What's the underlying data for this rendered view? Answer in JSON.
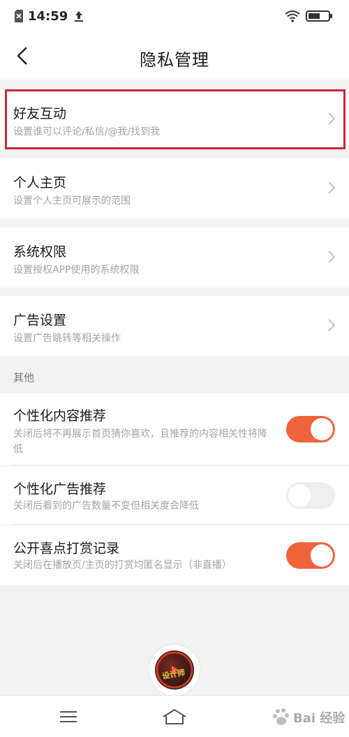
{
  "status_bar": {
    "time": "14:59"
  },
  "nav": {
    "title": "隐私管理"
  },
  "settings_rows": [
    {
      "title": "好友互动",
      "subtitle": "设置谁可以评论/私信/@我/找到我"
    },
    {
      "title": "个人主页",
      "subtitle": "设置个人主页可展示的范围"
    },
    {
      "title": "系统权限",
      "subtitle": "设置授权APP使用的系统权限"
    },
    {
      "title": "广告设置",
      "subtitle": "设置广告跳转等相关操作"
    }
  ],
  "other_section": {
    "header": "其他",
    "toggles": [
      {
        "title": "个性化内容推荐",
        "subtitle": "关闭后将不再展示首页猜你喜欢，且推荐的内容相关性将降低",
        "on": true
      },
      {
        "title": "个性化广告推荐",
        "subtitle": "关闭后看到的广告数量不变但相关度会降低",
        "on": false
      },
      {
        "title": "公开喜点打赏记录",
        "subtitle": "关闭后在播放页/主页的打赏均匿名显示（非直播）",
        "on": true
      }
    ]
  },
  "float_avatar": {
    "label": "设计师"
  },
  "watermark": {
    "text": "Bai 经验"
  },
  "colors": {
    "accent": "#f0623c",
    "highlight": "#c8283a",
    "background": "#f2f2f2"
  }
}
